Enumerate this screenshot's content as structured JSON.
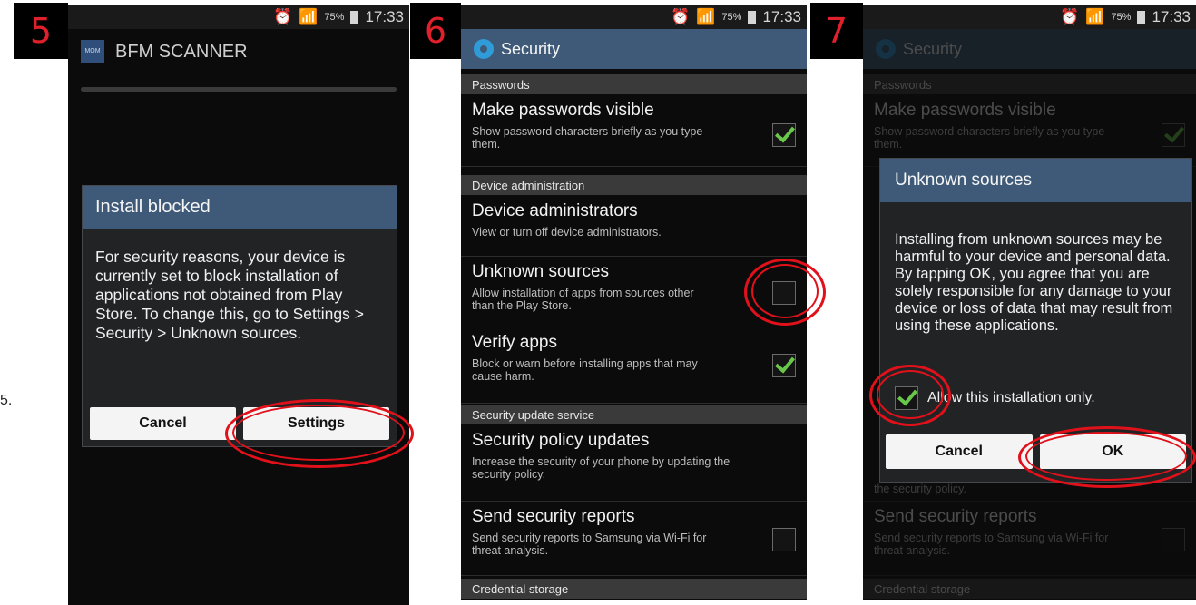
{
  "stray_text": "5.",
  "panels": [
    {
      "step": "5",
      "status": {
        "battery": "75%",
        "time": "17:33"
      },
      "app": {
        "logo_text": "MOM",
        "title": "BFM SCANNER"
      },
      "dialog": {
        "title": "Install blocked",
        "body": "For security reasons, your device is currently set to block installation of applications not obtained from Play Store. To change this, go to Settings > Security > Unknown sources.",
        "cancel": "Cancel",
        "settings": "Settings"
      }
    },
    {
      "step": "6",
      "status": {
        "battery": "75%",
        "time": "17:33"
      },
      "header": "Security",
      "sections": {
        "passwords": "Passwords",
        "device_admin": "Device administration",
        "update_service": "Security update service",
        "credential": "Credential storage"
      },
      "items": [
        {
          "title": "Make passwords visible",
          "desc": "Show password characters briefly as you type them.",
          "checked": true
        },
        {
          "title": "Device administrators",
          "desc": "View or turn off device administrators."
        },
        {
          "title": "Unknown sources",
          "desc": "Allow installation of apps from sources other than the Play Store.",
          "checked": false
        },
        {
          "title": "Verify apps",
          "desc": "Block or warn before installing apps that may cause harm.",
          "checked": true
        },
        {
          "title": "Security policy updates",
          "desc": "Increase the security of your phone by updating the security policy."
        },
        {
          "title": "Send security reports",
          "desc": "Send security reports to Samsung via Wi-Fi for threat analysis.",
          "checked": false
        }
      ]
    },
    {
      "step": "7",
      "status": {
        "battery": "75%",
        "time": "17:33"
      },
      "header": "Security",
      "bg_sections": {
        "passwords": "Passwords",
        "credential": "Credential storage"
      },
      "bg_items": {
        "passwords_title": "Make passwords visible",
        "passwords_desc": "Show password characters briefly as you type them.",
        "policy_desc_tail": "the security policy.",
        "reports_title": "Send security reports",
        "reports_desc": "Send security reports to Samsung via Wi-Fi for threat analysis."
      },
      "dialog": {
        "title": "Unknown sources",
        "body": "Installing from unknown sources may be harmful to your device and personal data. By tapping OK, you agree that you are solely responsible for any damage to your device or loss of data that may result from using these applications.",
        "checkbox_label": "Allow this installation only.",
        "checkbox_checked": true,
        "cancel": "Cancel",
        "ok": "OK"
      }
    }
  ],
  "colors": {
    "accent": "#3e5a78",
    "annotation": "#e0111a",
    "check": "#69c84a",
    "step_number": "#e0212c"
  }
}
